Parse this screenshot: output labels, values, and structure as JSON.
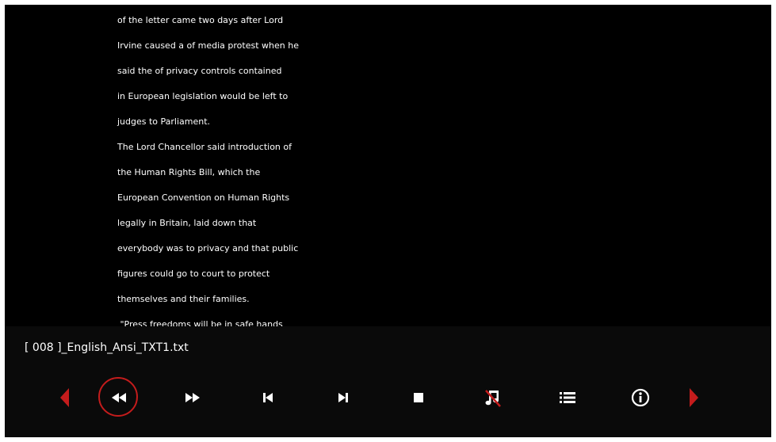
{
  "reader": {
    "lines": [
      "of the letter came two days after Lord",
      "Irvine caused a of media protest when he",
      "said the of privacy controls contained",
      "in European legislation would be left to",
      "judges to Parliament.",
      "The Lord Chancellor said introduction of",
      "the Human Rights Bill, which the",
      "European Convention on Human Rights",
      "legally in Britain, laid down that",
      "everybody was to privacy and that public",
      "figures could go to court to protect",
      "themselves and their families.",
      " \"Press freedoms will be in safe hands"
    ]
  },
  "player": {
    "filename": "[ 008 ]_English_Ansi_TXT1.txt",
    "selected_control": "rewind",
    "accent_color": "#c41c1c",
    "controls": [
      {
        "id": "prev-arrow",
        "icon": "triangle-left-icon"
      },
      {
        "id": "rewind",
        "icon": "rewind-icon"
      },
      {
        "id": "fast-forward",
        "icon": "fast-forward-icon"
      },
      {
        "id": "skip-previous",
        "icon": "skip-previous-icon"
      },
      {
        "id": "skip-next",
        "icon": "skip-next-icon"
      },
      {
        "id": "stop",
        "icon": "stop-icon"
      },
      {
        "id": "music-off",
        "icon": "music-off-icon"
      },
      {
        "id": "playlist",
        "icon": "list-icon"
      },
      {
        "id": "info",
        "icon": "info-icon"
      },
      {
        "id": "next-arrow",
        "icon": "triangle-right-icon"
      }
    ]
  }
}
